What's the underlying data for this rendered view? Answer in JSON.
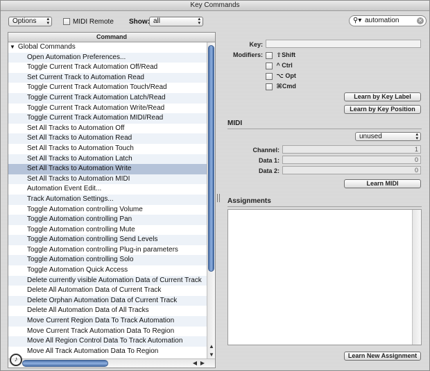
{
  "window": {
    "title": "Key Commands"
  },
  "toolbar": {
    "options_label": "Options",
    "midi_remote_label": "MIDI Remote",
    "show_label": "Show:",
    "show_value": "all",
    "search_value": "automation"
  },
  "list": {
    "column_header": "Command",
    "group_label": "Global Commands",
    "items": [
      "Open Automation Preferences...",
      "Toggle Current Track Automation Off/Read",
      "Set Current Track to Automation Read",
      "Toggle Current Track Automation Touch/Read",
      "Toggle Current Track Automation Latch/Read",
      "Toggle Current Track Automation Write/Read",
      "Toggle Current Track Automation MIDI/Read",
      "Set All Tracks to Automation Off",
      "Set All Tracks to Automation Read",
      "Set All Tracks to Automation Touch",
      "Set All Tracks to Automation Latch",
      "Set All Tracks to Automation Write",
      "Set All Tracks to Automation MIDI",
      "Automation Event Edit...",
      "Track Automation Settings...",
      "Toggle Automation controlling Volume",
      "Toggle Automation controlling Pan",
      "Toggle Automation controlling Mute",
      "Toggle Automation controlling Send Levels",
      "Toggle Automation controlling Plug-in parameters",
      "Toggle Automation controlling Solo",
      "Toggle Automation Quick Access",
      "Delete currently visible Automation Data of Current Track",
      "Delete All Automation Data of Current Track",
      "Delete Orphan Automation Data of Current Track",
      "Delete All Automation Data of All Tracks",
      "Move Current Region Data To Track Automation",
      "Move Current Track Automation Data To Region",
      "Move All Region Control Data To Track Automation",
      "Move All Track Automation Data To Region"
    ],
    "selected_index": 11
  },
  "key_section": {
    "key_label": "Key:",
    "key_value": "",
    "modifiers_label": "Modifiers:",
    "modifiers": [
      {
        "symbol": "⇧",
        "label": "Shift"
      },
      {
        "symbol": "^",
        "label": "Ctrl"
      },
      {
        "symbol": "⌥",
        "label": "Opt"
      },
      {
        "symbol": "⌘",
        "label": "Cmd"
      }
    ],
    "learn_by_label": "Learn by Key Label",
    "learn_by_position": "Learn by Key Position"
  },
  "midi_section": {
    "title": "MIDI",
    "type_value": "unused",
    "channel_label": "Channel:",
    "channel_value": "1",
    "data1_label": "Data 1:",
    "data1_value": "0",
    "data2_label": "Data 2:",
    "data2_value": "0",
    "learn_midi": "Learn MIDI"
  },
  "assignments_section": {
    "title": "Assignments",
    "learn_new": "Learn New Assignment"
  }
}
